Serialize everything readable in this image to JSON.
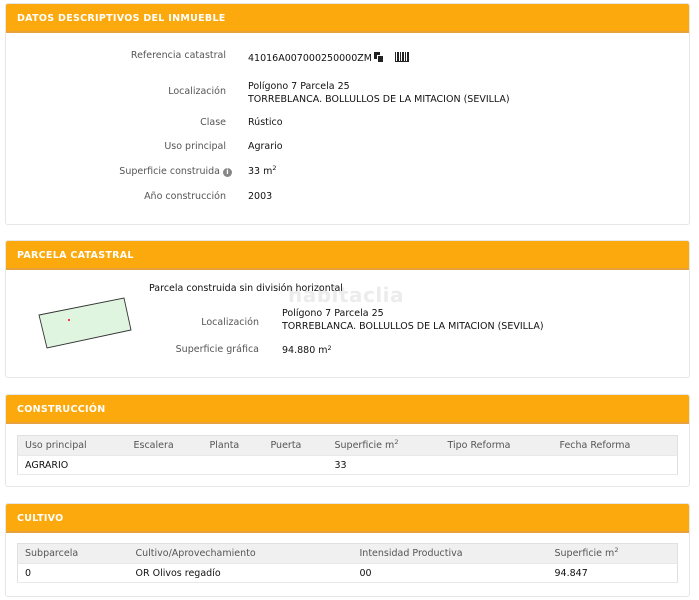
{
  "inmueble": {
    "title": "DATOS DESCRIPTIVOS DEL INMUEBLE",
    "referencia_label": "Referencia catastral",
    "referencia_value": "41016A007000250000ZM",
    "localizacion_label": "Localización",
    "localizacion_line1": "Polígono 7 Parcela 25",
    "localizacion_line2": "TORREBLANCA. BOLLULLOS DE LA MITACION (SEVILLA)",
    "clase_label": "Clase",
    "clase_value": "Rústico",
    "uso_label": "Uso principal",
    "uso_value": "Agrario",
    "superficie_label": "Superficie construida",
    "superficie_value": "33 m",
    "superficie_sup": "2",
    "anio_label": "Año construcción",
    "anio_value": "2003"
  },
  "parcela": {
    "title": "PARCELA CATASTRAL",
    "subtitle": "Parcela construida sin división horizontal",
    "localizacion_label": "Localización",
    "localizacion_line1": "Polígono 7 Parcela 25",
    "localizacion_line2": "TORREBLANCA. BOLLULLOS DE LA MITACION (SEVILLA)",
    "superficie_label": "Superficie gráfica",
    "superficie_value": "94.880 m",
    "superficie_sup": "2",
    "watermark": "habitaclia"
  },
  "construccion": {
    "title": "CONSTRUCCIÓN",
    "headers": [
      "Uso principal",
      "Escalera",
      "Planta",
      "Puerta",
      "Superficie m",
      "Tipo Reforma",
      "Fecha Reforma"
    ],
    "header_sup": "2",
    "row": [
      "AGRARIO",
      "",
      "",
      "",
      "33",
      "",
      ""
    ]
  },
  "cultivo": {
    "title": "CULTIVO",
    "headers": [
      "Subparcela",
      "Cultivo/Aprovechamiento",
      "Intensidad Productiva",
      "Superficie m"
    ],
    "header_sup": "2",
    "row": [
      "0",
      "OR Olivos regadío",
      "00",
      "94.847"
    ]
  },
  "colors": {
    "header_bg": "#fba90d",
    "parcel_fill": "#e0f5df"
  }
}
